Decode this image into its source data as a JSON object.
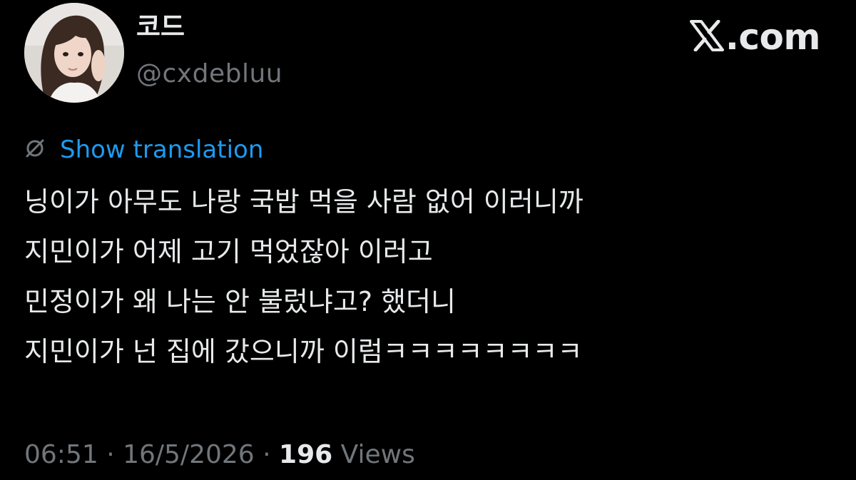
{
  "author": {
    "display_name": "코드",
    "handle": "@cxdebluu",
    "avatar_icon": "profile-photo"
  },
  "brand": {
    "icon": "x-logo-icon",
    "text": ".com"
  },
  "translation": {
    "icon": "globe-slash-icon",
    "label": "Show translation",
    "color": "#1d9bf0"
  },
  "tweet": {
    "lines": [
      "닝이가 아무도 나랑 국밥 먹을 사람 없어 이러니까",
      "지민이가 어제 고기 먹었잖아 이러고",
      "민정이가 왜 나는 안 불렀냐고? 했더니",
      "지민이가 넌 집에 갔으니까 이럼ㅋㅋㅋㅋㅋㅋㅋㅋ"
    ]
  },
  "meta": {
    "time": "06:51",
    "separator": " · ",
    "date": "16/5/2026",
    "views_count": "196",
    "views_label": "Views"
  },
  "colors": {
    "background": "#000000",
    "text_primary": "#e7e9ea",
    "text_secondary": "#71767b",
    "accent": "#1d9bf0"
  }
}
